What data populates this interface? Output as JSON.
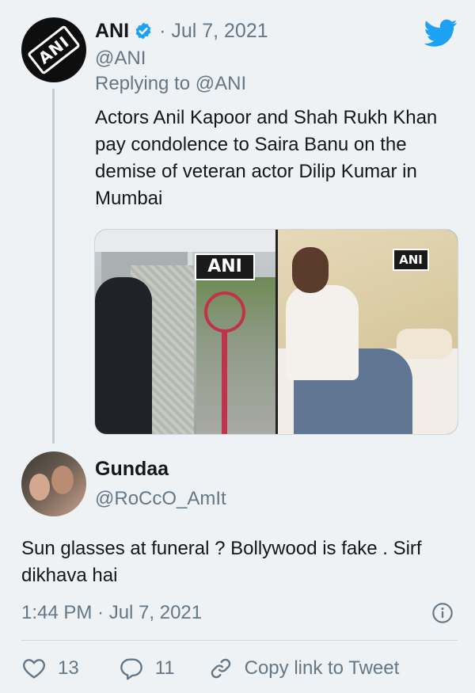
{
  "parent_tweet": {
    "name": "ANI",
    "date": "· Jul 7, 2021",
    "handle": "@ANI",
    "replying_prefix": "Replying to ",
    "replying_to": "@ANI",
    "text": "Actors Anil Kapoor and Shah Rukh Khan pay condolence to Saira Banu on the demise of veteran actor Dilip Kumar in Mumbai",
    "avatar_logo": "ANI",
    "media_watermark_left": "ANI",
    "media_watermark_right": "ANI"
  },
  "reply_tweet": {
    "name": "Gundaa",
    "handle": "@RoCcO_AmIt",
    "text": "Sun glasses at funeral ? Bollywood is fake . Sirf dikhava hai",
    "timestamp": "1:44 PM · Jul 7, 2021"
  },
  "actions": {
    "likes": "13",
    "replies": "11",
    "copy_link": "Copy link to Tweet"
  },
  "colors": {
    "background": "#eef2f5",
    "primary_text": "#14171a",
    "secondary_text": "#657786",
    "twitter_blue": "#1da1f2"
  },
  "icons": [
    "verified-badge-icon",
    "twitter-bird-icon",
    "info-icon",
    "heart-icon",
    "reply-bubble-icon",
    "link-icon"
  ]
}
